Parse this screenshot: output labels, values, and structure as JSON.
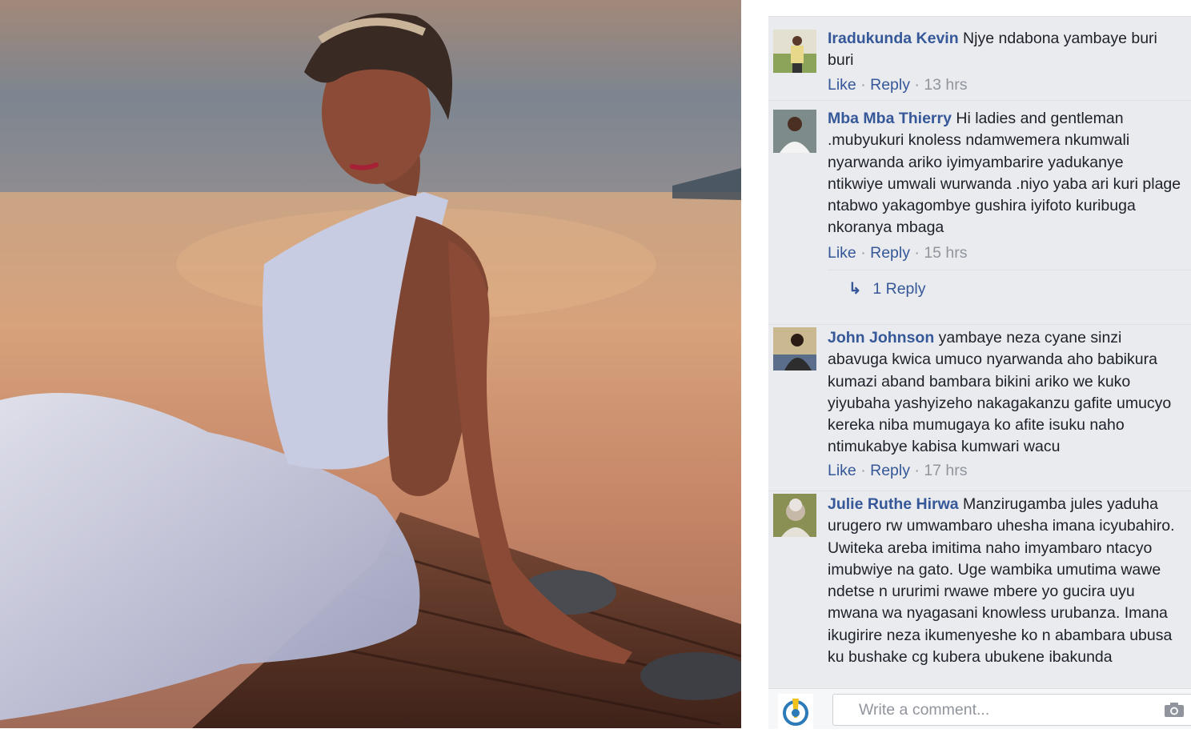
{
  "comments": [
    {
      "author": "Iradukunda Kevin",
      "text": "Njye ndabona yambaye buri buri",
      "like": "Like",
      "reply": "Reply",
      "time": "13 hrs"
    },
    {
      "author": "Mba Mba Thierry",
      "text": "Hi ladies and gentleman .mubyukuri knoless ndamwemera nkumwali nyarwanda ariko iyimyambarire yadukanye ntikwiye umwali wurwanda .niyo yaba ari kuri plage ntabwo yakagombye gushira iyifoto kuribuga nkoranya mbaga",
      "like": "Like",
      "reply": "Reply",
      "time": "15 hrs",
      "replies_link": "1 Reply"
    },
    {
      "author": "John Johnson",
      "text": "yambaye neza cyane sinzi abavuga kwica umuco nyarwanda aho babikura kumazi aband bambara bikini ariko we kuko yiyubaha yashyizeho nakagakanzu gafite umucyo kereka niba mumugaya ko afite isuku naho ntimukabye kabisa kumwari wacu",
      "like": "Like",
      "reply": "Reply",
      "time": "17 hrs"
    },
    {
      "author": "Julie Ruthe Hirwa",
      "text": "Manzirugamba jules yaduha urugero rw umwambaro uhesha imana icyubahiro. Uwiteka areba imitima naho imyambaro ntacyo imubwiye na gato. Uge wambika umutima wawe ndetse n ururimi rwawe mbere yo gucira uyu mwana wa nyagasani knowless urubanza. Imana ikugirire neza ikumenyeshe ko n abambara ubusa ku bushake cg kubera ubukene ibakunda"
    }
  ],
  "composer": {
    "placeholder": "Write a comment..."
  }
}
